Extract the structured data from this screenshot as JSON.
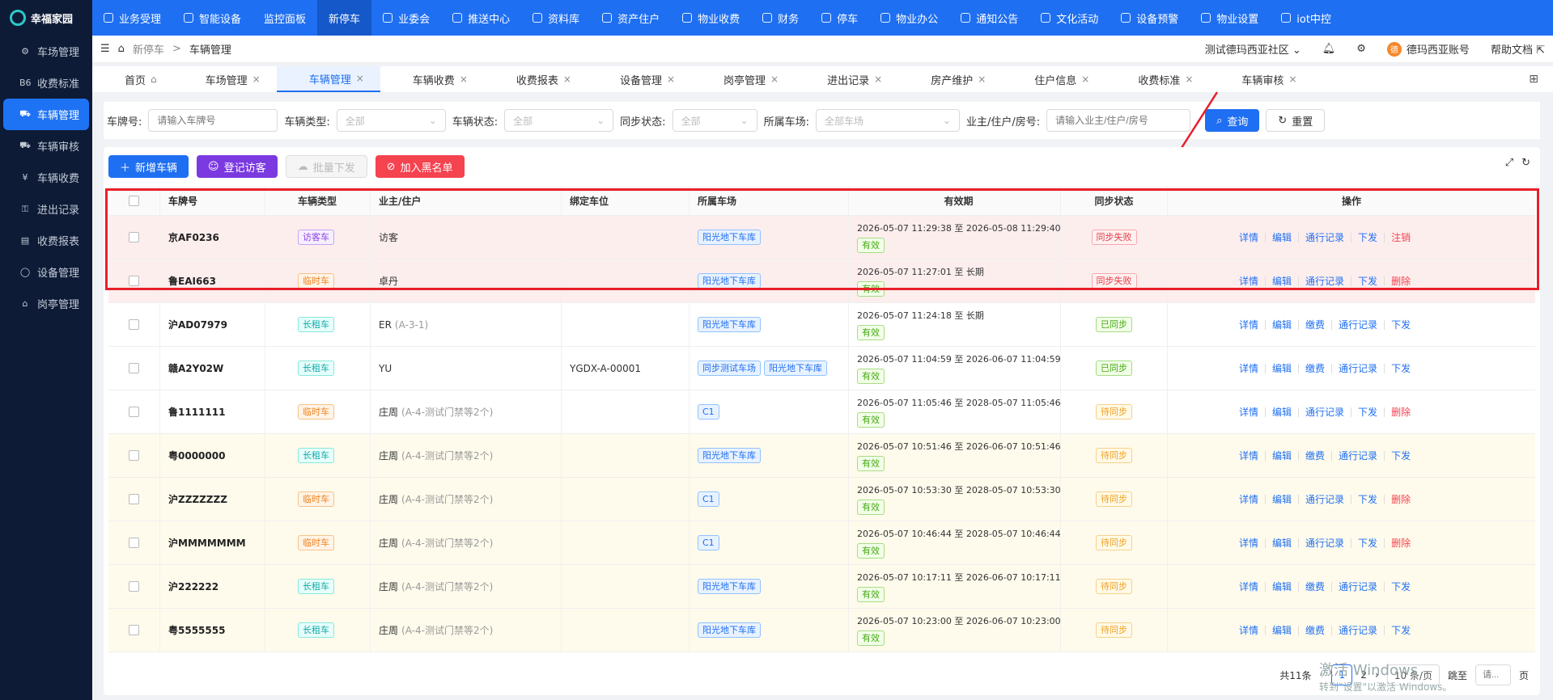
{
  "app": {
    "title": "幸福家园"
  },
  "top_nav": [
    {
      "label": "业务受理",
      "icon": "desktop-icon"
    },
    {
      "label": "智能设备",
      "icon": "device-icon"
    },
    {
      "label": "监控面板",
      "icon": ""
    },
    {
      "label": "新停车",
      "icon": "",
      "active": true
    },
    {
      "label": "业委会",
      "icon": "building-icon"
    },
    {
      "label": "推送中心",
      "icon": "chat-icon"
    },
    {
      "label": "资料库",
      "icon": "file-icon"
    },
    {
      "label": "资产住户",
      "icon": "home-icon"
    },
    {
      "label": "物业收费",
      "icon": "bill-icon"
    },
    {
      "label": "财务",
      "icon": "finance-icon"
    },
    {
      "label": "停车",
      "icon": "parking-icon"
    },
    {
      "label": "物业办公",
      "icon": "office-icon"
    },
    {
      "label": "通知公告",
      "icon": "megaphone-icon"
    },
    {
      "label": "文化活动",
      "icon": "shield-icon"
    },
    {
      "label": "设备预警",
      "icon": "alarm-icon"
    },
    {
      "label": "物业设置",
      "icon": "gear-icon"
    },
    {
      "label": "iot中控",
      "icon": "cube-icon"
    }
  ],
  "sidebar": [
    {
      "label": "车场管理",
      "icon": "gear"
    },
    {
      "label": "收费标准",
      "icon": "B6"
    },
    {
      "label": "车辆管理",
      "icon": "car",
      "active": true
    },
    {
      "label": "车辆审核",
      "icon": "car"
    },
    {
      "label": "车辆收费",
      "icon": "coin"
    },
    {
      "label": "进出记录",
      "icon": "key"
    },
    {
      "label": "收费报表",
      "icon": "report"
    },
    {
      "label": "设备管理",
      "icon": "chat"
    },
    {
      "label": "岗亭管理",
      "icon": "booth"
    }
  ],
  "header": {
    "breadcrumb": [
      "新停车",
      "车辆管理"
    ],
    "community": "测试德玛西亚社区",
    "avatar_text": "德",
    "account": "德玛西亚账号",
    "help": "帮助文档"
  },
  "tabs": [
    {
      "label": "首页"
    },
    {
      "label": "车场管理"
    },
    {
      "label": "车辆管理",
      "active": true
    },
    {
      "label": "车辆收费"
    },
    {
      "label": "收费报表"
    },
    {
      "label": "设备管理"
    },
    {
      "label": "岗亭管理"
    },
    {
      "label": "进出记录"
    },
    {
      "label": "房产维护"
    },
    {
      "label": "住户信息"
    },
    {
      "label": "收费标准"
    },
    {
      "label": "车辆审核"
    }
  ],
  "filters": {
    "plate_label": "车牌号:",
    "plate_placeholder": "请输入车牌号",
    "type_label": "车辆类型:",
    "type_value": "全部",
    "status_label": "车辆状态:",
    "status_value": "全部",
    "sync_label": "同步状态:",
    "sync_value": "全部",
    "park_label": "所属车场:",
    "park_value": "全部车场",
    "owner_label": "业主/住户/房号:",
    "owner_placeholder": "请输入业主/住户/房号",
    "query": "查询",
    "reset": "重置"
  },
  "actions": {
    "add": "新增车辆",
    "visitor": "登记访客",
    "batch": "批量下发",
    "blacklist": "加入黑名单"
  },
  "annotation": "同步失败",
  "table": {
    "headers": [
      "车牌号",
      "车辆类型",
      "业主/住户",
      "绑定车位",
      "所属车场",
      "有效期",
      "同步状态",
      "操作"
    ],
    "rows": [
      {
        "plate": "京AF0236",
        "type": "访客车",
        "owner": "访客",
        "owner_sub": "",
        "space": "",
        "parks": [
          "阳光地下车库"
        ],
        "valid": "2026-05-07 11:29:38 至 2026-05-08 11:29:40",
        "valid_tag": "有效",
        "sync": "同步失败",
        "ops": [
          "详情",
          "编辑",
          "通行记录",
          "下发",
          "注销"
        ],
        "state": "err"
      },
      {
        "plate": "鲁EAI663",
        "type": "临时车",
        "owner": "卓丹",
        "owner_sub": "",
        "space": "",
        "parks": [
          "阳光地下车库"
        ],
        "valid": "2026-05-07 11:27:01 至 长期",
        "valid_tag": "有效",
        "sync": "同步失败",
        "ops": [
          "详情",
          "编辑",
          "通行记录",
          "下发",
          "删除"
        ],
        "state": "err"
      },
      {
        "plate": "沪AD07979",
        "type": "长租车",
        "owner": "ER",
        "owner_sub": "(A-3-1)",
        "space": "",
        "parks": [
          "阳光地下车库"
        ],
        "valid": "2026-05-07 11:24:18 至 长期",
        "valid_tag": "有效",
        "sync": "已同步",
        "ops": [
          "详情",
          "编辑",
          "缴费",
          "通行记录",
          "下发"
        ],
        "state": "ok"
      },
      {
        "plate": "赣A2Y02W",
        "type": "长租车",
        "owner": "YU",
        "owner_sub": "",
        "space": "YGDX-A-00001",
        "parks": [
          "同步测试车场",
          "阳光地下车库"
        ],
        "valid": "2026-05-07 11:04:59 至 2026-06-07 11:04:59",
        "valid_tag": "有效",
        "sync": "已同步",
        "ops": [
          "详情",
          "编辑",
          "缴费",
          "通行记录",
          "下发"
        ],
        "state": "ok"
      },
      {
        "plate": "鲁1111111",
        "type": "临时车",
        "owner": "庄周",
        "owner_sub": "(A-4-测试门禁等2个)",
        "space": "",
        "parks": [
          "C1"
        ],
        "valid": "2026-05-07 11:05:46 至 2028-05-07 11:05:46",
        "valid_tag": "有效",
        "sync": "待同步",
        "ops": [
          "详情",
          "编辑",
          "通行记录",
          "下发",
          "删除"
        ],
        "state": "plain"
      },
      {
        "plate": "粤0000000",
        "type": "长租车",
        "owner": "庄周",
        "owner_sub": "(A-4-测试门禁等2个)",
        "space": "",
        "parks": [
          "阳光地下车库"
        ],
        "valid": "2026-05-07 10:51:46 至 2026-06-07 10:51:46",
        "valid_tag": "有效",
        "sync": "待同步",
        "ops": [
          "详情",
          "编辑",
          "缴费",
          "通行记录",
          "下发"
        ],
        "state": "pend"
      },
      {
        "plate": "沪ZZZZZZZ",
        "type": "临时车",
        "owner": "庄周",
        "owner_sub": "(A-4-测试门禁等2个)",
        "space": "",
        "parks": [
          "C1"
        ],
        "valid": "2026-05-07 10:53:30 至 2028-05-07 10:53:30",
        "valid_tag": "有效",
        "sync": "待同步",
        "ops": [
          "详情",
          "编辑",
          "通行记录",
          "下发",
          "删除"
        ],
        "state": "pend"
      },
      {
        "plate": "沪MMMMMMM",
        "type": "临时车",
        "owner": "庄周",
        "owner_sub": "(A-4-测试门禁等2个)",
        "space": "",
        "parks": [
          "C1"
        ],
        "valid": "2026-05-07 10:46:44 至 2028-05-07 10:46:44",
        "valid_tag": "有效",
        "sync": "待同步",
        "ops": [
          "详情",
          "编辑",
          "通行记录",
          "下发",
          "删除"
        ],
        "state": "pend"
      },
      {
        "plate": "沪222222",
        "type": "长租车",
        "owner": "庄周",
        "owner_sub": "(A-4-测试门禁等2个)",
        "space": "",
        "parks": [
          "阳光地下车库"
        ],
        "valid": "2026-05-07 10:17:11 至 2026-06-07 10:17:11",
        "valid_tag": "有效",
        "sync": "待同步",
        "ops": [
          "详情",
          "编辑",
          "缴费",
          "通行记录",
          "下发"
        ],
        "state": "pend"
      },
      {
        "plate": "粤5555555",
        "type": "长租车",
        "owner": "庄周",
        "owner_sub": "(A-4-测试门禁等2个)",
        "space": "",
        "parks": [
          "阳光地下车库"
        ],
        "valid": "2026-05-07 10:23:00 至 2026-06-07 10:23:00",
        "valid_tag": "有效",
        "sync": "待同步",
        "ops": [
          "详情",
          "编辑",
          "缴费",
          "通行记录",
          "下发"
        ],
        "state": "pend"
      }
    ]
  },
  "pager": {
    "total": "共11条",
    "page": "1",
    "next_page": "2",
    "page_size": "10 条/页",
    "jump": "跳至",
    "jump_placeholder": "请...",
    "page_unit": "页"
  },
  "watermark": {
    "line1": "激活 Windows",
    "line2": "转到\"设置\"以激活 Windows。"
  }
}
